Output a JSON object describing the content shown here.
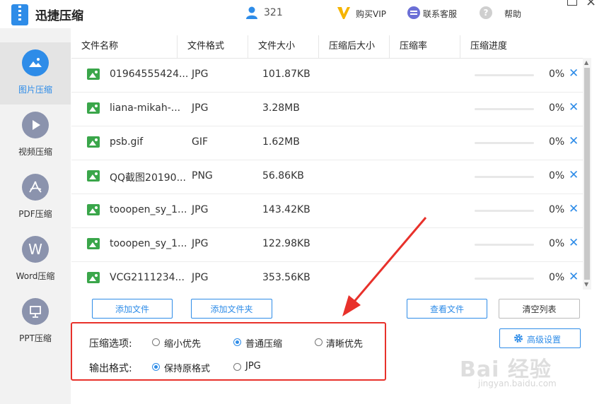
{
  "app": {
    "title": "迅捷压缩"
  },
  "header": {
    "user_count": "321",
    "vip": "购买VIP",
    "service": "联系客服",
    "help_glyph": "?",
    "help": "帮助",
    "close_glyph": "×"
  },
  "sidebar": {
    "items": [
      {
        "label": "图片压缩",
        "icon": "image-icon"
      },
      {
        "label": "视频压缩",
        "icon": "play-icon"
      },
      {
        "label": "PDF压缩",
        "icon": "pdf-icon"
      },
      {
        "label": "Word压缩",
        "icon": "word-icon",
        "glyph": "W"
      },
      {
        "label": "PPT压缩",
        "icon": "ppt-icon"
      }
    ]
  },
  "table": {
    "headers": [
      "文件名称",
      "文件格式",
      "文件大小",
      "压缩后大小",
      "压缩率",
      "压缩进度"
    ],
    "rows": [
      {
        "name": "01964555424...",
        "format": "JPG",
        "size": "101.87KB",
        "progress": "0%"
      },
      {
        "name": "liana-mikah-...",
        "format": "JPG",
        "size": "3.28MB",
        "progress": "0%"
      },
      {
        "name": "psb.gif",
        "format": "GIF",
        "size": "1.62MB",
        "progress": "0%"
      },
      {
        "name": "QQ截图20190...",
        "format": "PNG",
        "size": "56.86KB",
        "progress": "0%"
      },
      {
        "name": "tooopen_sy_1...",
        "format": "JPG",
        "size": "143.42KB",
        "progress": "0%"
      },
      {
        "name": "tooopen_sy_1...",
        "format": "JPG",
        "size": "122.98KB",
        "progress": "0%"
      },
      {
        "name": "VCG2111234...",
        "format": "JPG",
        "size": "353.56KB",
        "progress": "0%"
      }
    ],
    "remove_glyph": "✕"
  },
  "buttons": {
    "add_file": "添加文件",
    "add_folder": "添加文件夹",
    "view_files": "查看文件",
    "clear_list": "清空列表",
    "advanced": "高级设置"
  },
  "options": {
    "compress_label": "压缩选项:",
    "compress_choices": [
      "缩小优先",
      "普通压缩",
      "清晰优先"
    ],
    "compress_selected": 1,
    "output_label": "输出格式:",
    "output_choices": [
      "保持原格式",
      "JPG"
    ],
    "output_selected": 0
  },
  "colors": {
    "accent": "#2e8ce8",
    "highlight": "#e8312b"
  },
  "watermark": {
    "logo": "Bai 经验",
    "url": "jingyan.baidu.com"
  }
}
